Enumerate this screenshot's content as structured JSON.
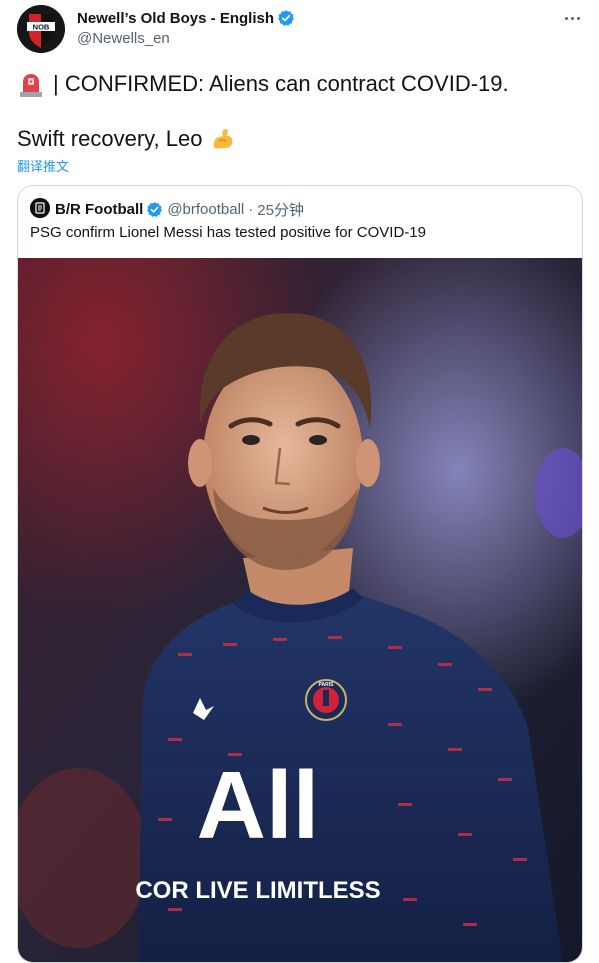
{
  "tweet": {
    "author_name": "Newell’s Old Boys - English",
    "author_handle": "@Newells_en",
    "avatar_text": "NOB",
    "line1": "| CONFIRMED: Aliens can contract COVID-19.",
    "line2": "Swift recovery, Leo",
    "translate_label": "翻译推文",
    "icons": {
      "verified": "verified-badge-icon",
      "more": "more-options-icon",
      "siren": "police-siren-emoji",
      "muscle": "flexed-biceps-emoji"
    }
  },
  "quote": {
    "name": "B/R Football",
    "handle": "@brfootball",
    "separator": "·",
    "time": "25分钟",
    "text": "PSG confirm Lionel Messi has tested positive for COVID-19",
    "media": {
      "kit_sponsor_top": "All",
      "kit_sponsor_bottom": "COR LIVE LIMITLESS",
      "crest_text": "PARIS"
    }
  },
  "colors": {
    "link": "#1d9bf0",
    "secondary_text": "#536471",
    "border": "#cfd9de",
    "nob_red": "#d2232a",
    "psg_navy": "#1b2a55"
  }
}
